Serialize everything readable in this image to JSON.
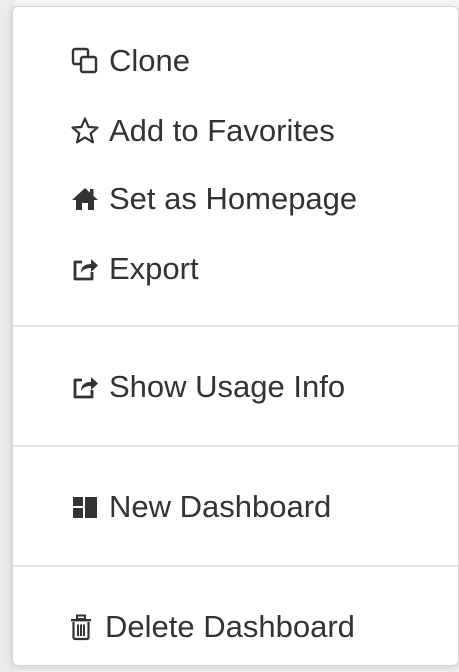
{
  "menu": {
    "items": [
      {
        "label": "Clone",
        "icon": "clone-icon"
      },
      {
        "label": "Add to Favorites",
        "icon": "star-outline-icon"
      },
      {
        "label": "Set as Homepage",
        "icon": "home-icon"
      },
      {
        "label": "Export",
        "icon": "share-export-icon"
      },
      {
        "label": "Show Usage Info",
        "icon": "share-export-icon"
      },
      {
        "label": "New Dashboard",
        "icon": "dashboard-icon"
      },
      {
        "label": "Delete Dashboard",
        "icon": "trash-icon"
      }
    ]
  },
  "colors": {
    "text": "#333333",
    "divider": "#e5e5e5",
    "menu_background": "#ffffff"
  }
}
